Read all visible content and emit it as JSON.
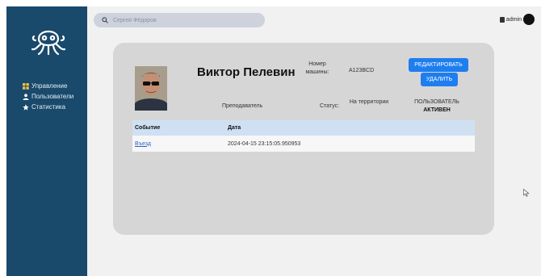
{
  "sidebar": {
    "logo_icon": "octopus-icon",
    "items": [
      {
        "icon": "grid-icon",
        "label": "Управление"
      },
      {
        "icon": "user-icon",
        "label": "Пользователи"
      },
      {
        "icon": "star-icon",
        "label": "Статистика"
      }
    ]
  },
  "header": {
    "search_placeholder": "Сергей Фёдоров",
    "user": "admin"
  },
  "profile": {
    "name": "Виктор Пелевин",
    "car_label": "Номер машины:",
    "car_value": "A123BCD",
    "role": "Преподаватель",
    "status_label": "Статус:",
    "status_value": "На территории",
    "user_state_line1": "ПОЛЬЗОВАТЕЛЬ",
    "user_state_line2": "АКТИВЕН",
    "edit_label": "РЕДАКТИРОВАТЬ",
    "delete_label": "УДАЛИТЬ"
  },
  "events": {
    "headers": [
      "Событие",
      "Дата"
    ],
    "rows": [
      {
        "event": "Въезд",
        "date": "2024-04-15 23:15:05.950953"
      }
    ]
  },
  "colors": {
    "sidebar": "#19496b",
    "accent": "#1e7ef0",
    "card": "#d6d6d6",
    "table_header": "#cfe0f3"
  }
}
